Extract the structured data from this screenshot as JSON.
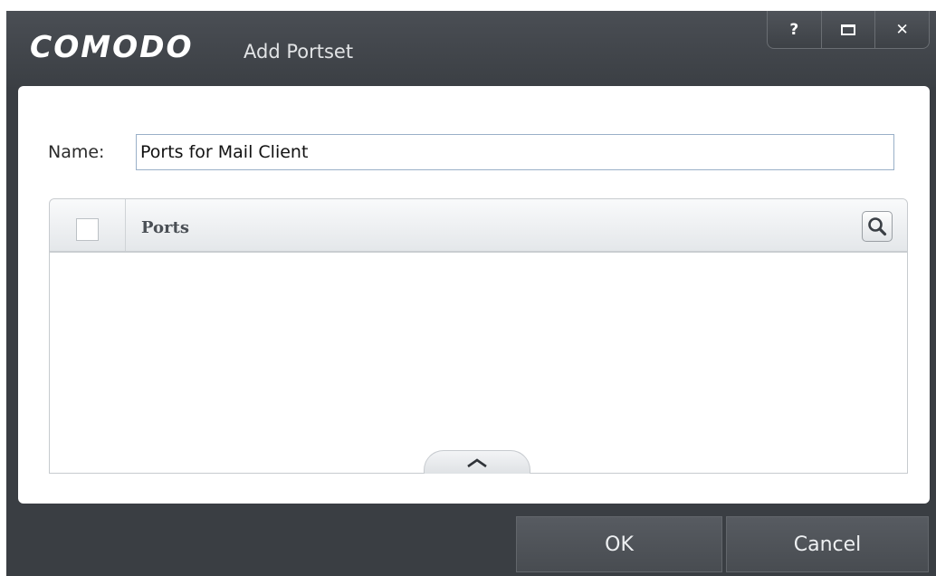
{
  "window": {
    "brand": "COMODO",
    "title": "Add Portset",
    "controls": {
      "help_label": "?",
      "close_label": "✕"
    }
  },
  "form": {
    "name_label": "Name:",
    "name_value": "Ports for Mail Client"
  },
  "table": {
    "column_header": "Ports",
    "rows": [],
    "header_checkbox_checked": false
  },
  "footer": {
    "ok_label": "OK",
    "cancel_label": "Cancel"
  },
  "icons": {
    "search": "search-icon",
    "collapse": "chevron-up-icon",
    "maximize": "maximize-icon",
    "help": "help-icon",
    "close": "close-icon"
  },
  "colors": {
    "titlebar": "#3b3f44",
    "content_bg": "#ffffff",
    "input_border": "#9ab0c8"
  }
}
